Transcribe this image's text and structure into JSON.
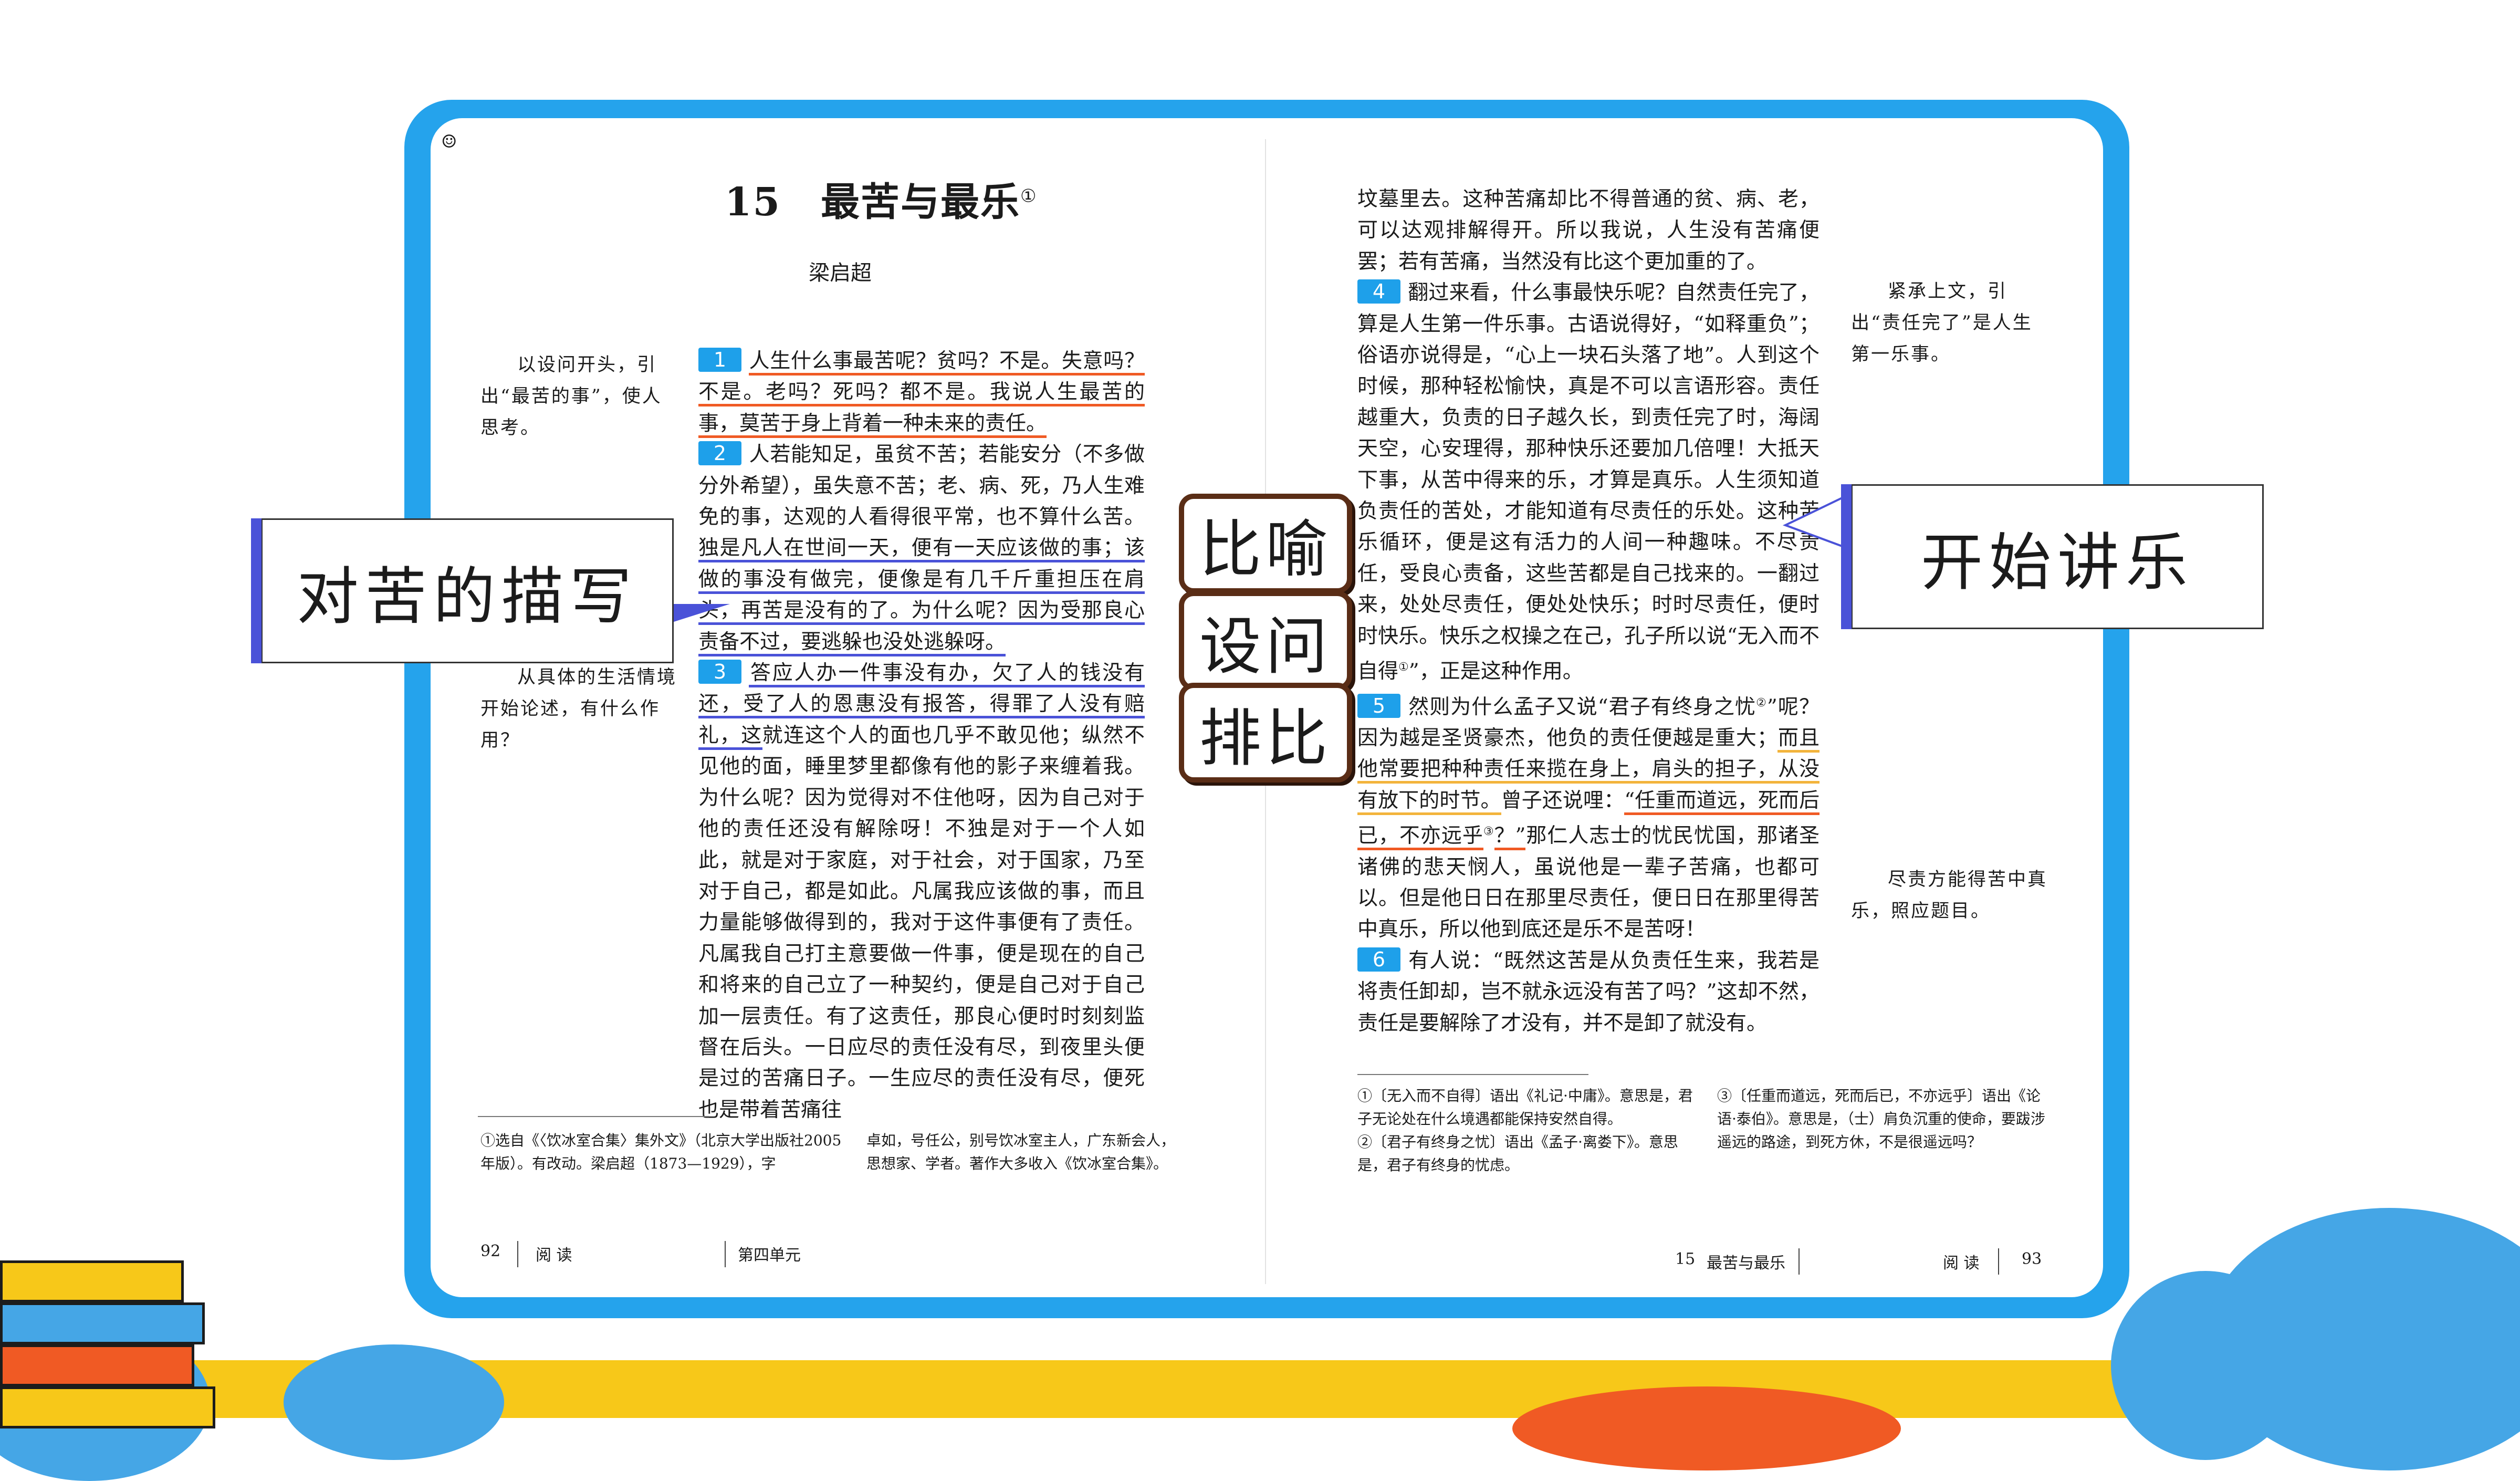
{
  "left_page": {
    "title": "15　最苦与最乐",
    "title_footnote_mark": "①",
    "author": "梁启超",
    "para1_num": "1",
    "para1": [
      "人生什么事最苦呢？贫吗？不是。失意吗？不是。老吗？死吗？都不是。我说人生最苦的事，莫苦于身上背着一种未来的责任。"
    ],
    "para2_num": "2",
    "para2_a": "人若能知足，虽贫不苦；若能安分（不多做分外希望），虽失意不苦；老、病、死，乃人生难免的事，达观的人看得很平常，也不算什么苦。",
    "para2_b": "独是凡人在世间一天，便有一天应该做的事；该做的事没有做完，便像是有几千斤重担压在肩头，再苦是没有的了。",
    "para2_c": "为什么呢？因为受那良心责备不过，要逃躲也没处逃躲呀。",
    "para3_num": "3",
    "para3_a": "答应人办一件事没有办，欠了人的钱没有还，受了人的恩惠没有报答，得罪了人没有赔礼，这",
    "para3_b": "就连这个人的面也几乎不敢见他；纵然不见他的面，睡里梦里都像有他的影子来缠着我。为什么呢？因为觉得对不住他呀，因为自己对于他的责任还没有解除呀！不独是对于一个人如此，就是对于家庭，对于社会，对于国家，乃至对于自己，都是如此。凡属我应该做的事，而且力量能够做得到的，我对于这件事便有了责任。凡属我自己打主意要做一件事，便是现在的自己和将来的自己立了一种契约，便是自己对于自己加一层责任。有了这责任，那良心便时时刻刻监督在后头。一日应尽的责任没有尽，到夜里头便是过的苦痛日子。一生应尽的责任没有尽，便死也是带着苦痛往",
    "note1": "以设问开头，引出“最苦的事”，使人思考。",
    "note2": "从具体的生活情境开始论述，有什么作用？",
    "footnote_a": "①选自《〈饮冰室合集〉集外文》（北京大学出版社2005年版）。有改动。梁启超（1873—1929），字",
    "footnote_b": "卓如，号任公，别号饮冰室主人，广东新会人，思想家、学者。著作大多收入《饮冰室合集》。",
    "footer_page": "92",
    "footer_label": "阅 读",
    "footer_unit": "第四单元"
  },
  "right_page": {
    "para3_end": "坟墓里去。这种苦痛却比不得普通的贫、病、老，可以达观排解得开。所以我说，人生没有苦痛便罢；若有苦痛，当然没有比这个更加重的了。",
    "para4_num": "4",
    "para4_a": "翻过来看，什么事最快乐呢？自然责任完了，算是人生第一件乐事。古语说得好，“如释重负”；俗语亦说得是，“心上一块石头落了地”。人到这个时候，那种轻松愉快，真是不可以言语形容。责任越重大，负责的日子越久长，到责任完了时，海阔天空，心安理得，那种快乐还要加几倍哩！大抵天下事，从苦中得来的乐，才算是真乐。人生须知道负责任的苦处，才能知道有尽责任的乐处。这种苦乐循环，便是这有活力的人间一种趣味。不尽责任，受良心责备，这些苦都是自己找来的。一翻过来，处处尽责任，便处处快乐；时时尽责任，便时时快乐。快乐之权操之在己，孔子所以说“无入而不自得",
    "para4_mark": "①",
    "para4_end": "”，正是这种作用。",
    "para5_num": "5",
    "para5_a": "然则为什么孟子又说“君子有终身之忧",
    "para5_mark": "②",
    "para5_b": "”呢？因为越是圣贤豪杰，他负的责任便越是重大；",
    "para5_c": "而且他常要把种种责任来揽在身上，肩头的担子，从没有放下的时节。",
    "para5_d": "曾子还说哩：",
    "para5_e": "“任重而道远，死而后已，不亦远乎",
    "para5_mark2": "③",
    "para5_f": "？”",
    "para5_g": "那仁人志士的忧民忧国，那诸圣诸佛的悲天悯人，虽说他是一辈子苦痛，也都可以。但是他日日在那里尽责任，便日日在那里得苦中真乐，所以他到底还是乐不是苦呀！",
    "para6_num": "6",
    "para6": "有人说：“既然这苦是从负责任生来，我若是将责任卸却，岂不就永远没有苦了吗？”这却不然，责任是要解除了才没有，并不是卸了就没有。",
    "note3": "紧承上文，引出“责任完了”是人生第一乐事。",
    "note4": "尽责方能得苦中真乐，照应题目。",
    "fn1": "①〔无入而不自得〕语出《礼记·中庸》。意思是，君子无论处在什么境遇都能保持安然自得。",
    "fn2": "②〔君子有终身之忧〕语出《孟子·离娄下》。意思是，君子有终身的忧虑。",
    "fn3": "③〔任重而道远，死而后已，不亦远乎〕语出《论语·泰伯》。意思是，（士）肩负沉重的使命，要跋涉遥远的路途，到死方休，不是很遥远吗？",
    "footer_no": "15",
    "footer_title": "最苦与最乐",
    "footer_label": "阅 读",
    "footer_page": "93"
  },
  "annotations": {
    "left_box": "对苦的描写",
    "right_box": "开始讲乐",
    "tag1": "比喻",
    "tag2": "设问",
    "tag3": "排比"
  },
  "colors": {
    "frame_blue": "#25a3ec",
    "accent_orange": "#f05a24",
    "accent_blue": "#4a52d8",
    "accent_yellow": "#f3b43c"
  },
  "icons": {
    "page_corner": "smiley-icon"
  }
}
